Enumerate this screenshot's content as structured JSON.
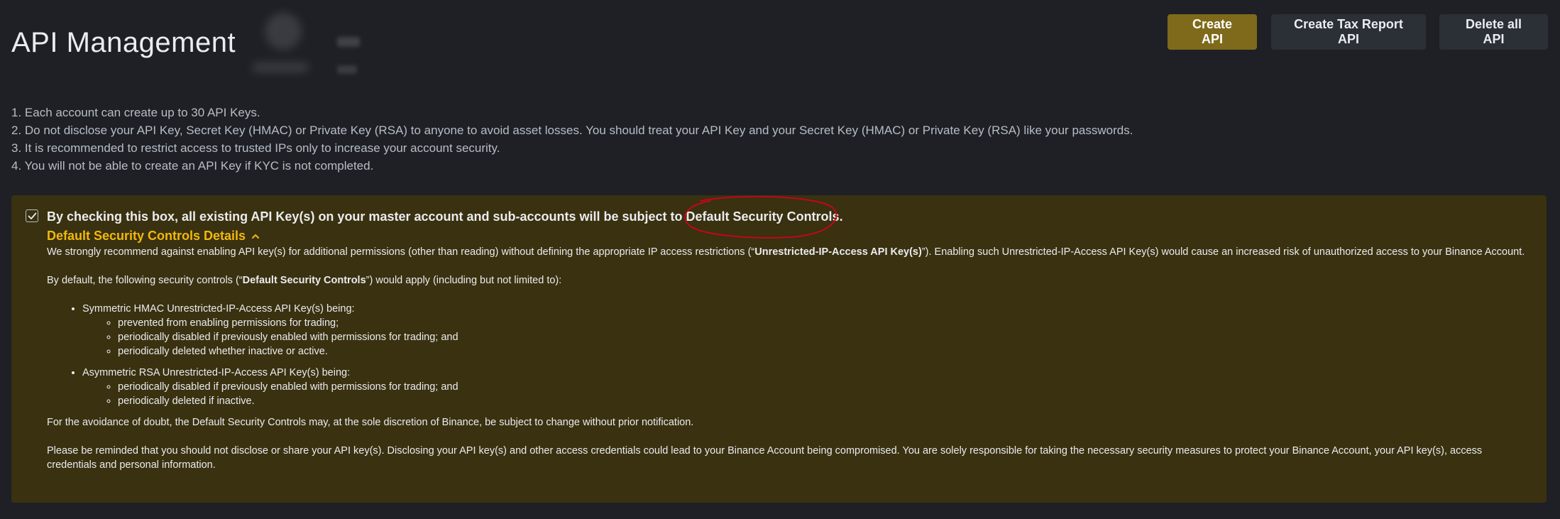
{
  "header": {
    "title": "API Management",
    "buttons": {
      "create": "Create API",
      "tax": "Create Tax Report API",
      "delete": "Delete all API"
    }
  },
  "notes": [
    "1. Each account can create up to 30 API Keys.",
    "2. Do not disclose your API Key, Secret Key (HMAC) or Private Key (RSA) to anyone to avoid asset losses. You should treat your API Key and your Secret Key (HMAC) or Private Key (RSA) like your passwords.",
    "3. It is recommended to restrict access to trusted IPs only to increase your account security.",
    "4. You will not be able to create an API Key if KYC is not completed."
  ],
  "security_panel": {
    "checked": true,
    "title_prefix": "By checking this box, all existing API Key(s) on your master account and sub-accounts will be subject to ",
    "title_highlight": "Default Security Controls.",
    "details_link": "Default Security Controls Details",
    "para1_a": "We strongly recommend against enabling API key(s) for additional permissions (other than reading) without defining the appropriate IP access restrictions (“",
    "para1_b": "Unrestricted-IP-Access API Key(s)",
    "para1_c": "”). Enabling such Unrestricted-IP-Access API Key(s) would cause an increased risk of unauthorized access to your Binance Account.",
    "para2_a": "By default, the following security controls (“",
    "para2_b": "Default Security Controls",
    "para2_c": "”) would apply (including but not limited to):",
    "hmac_heading": "Symmetric HMAC Unrestricted-IP-Access API Key(s) being:",
    "hmac_items": [
      "prevented from enabling permissions for trading;",
      "periodically disabled if previously enabled with permissions for trading; and",
      "periodically deleted whether inactive or active."
    ],
    "rsa_heading": "Asymmetric RSA Unrestricted-IP-Access API Key(s) being:",
    "rsa_items": [
      "periodically disabled if previously enabled with permissions for trading; and",
      "periodically deleted if inactive."
    ],
    "para3": "For the avoidance of doubt, the Default Security Controls may, at the sole discretion of Binance, be subject to change without prior notification.",
    "para4": "Please be reminded that you should not disclose or share your API key(s). Disclosing your API key(s) and other access credentials could lead to your Binance Account being compromised. You are solely responsible for taking the necessary security measures to protect your Binance Account, your API key(s), access credentials and personal information."
  },
  "colors": {
    "background": "#1e2026",
    "accent": "#f0b90b",
    "primary_button": "#7e6a1a",
    "panel": "#3a3110",
    "annotation": "#d0021b"
  },
  "icons": {
    "checkbox": "check-icon",
    "details_toggle": "chevron-up-icon"
  }
}
